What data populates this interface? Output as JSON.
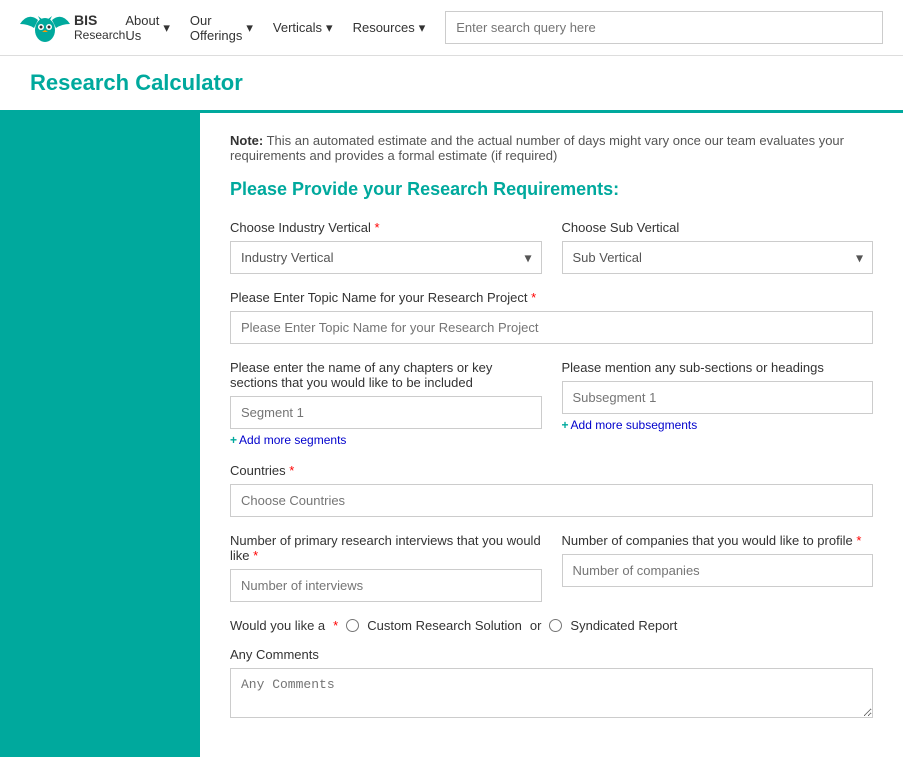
{
  "brand": {
    "bis": "BIS",
    "research": "Research"
  },
  "nav": {
    "items": [
      {
        "label": "About Us",
        "id": "about-us"
      },
      {
        "label": "Our Offerings",
        "id": "our-offerings"
      },
      {
        "label": "Verticals",
        "id": "verticals"
      },
      {
        "label": "Resources",
        "id": "resources"
      }
    ]
  },
  "search": {
    "placeholder": "Enter search query here"
  },
  "page_title": {
    "prefix": "Research ",
    "highlight": "Calculator"
  },
  "note": {
    "label": "Note:",
    "text": " This an automated estimate and the actual number of days might vary once our team evaluates your requirements and provides a formal estimate (if required)"
  },
  "form": {
    "heading": "Please Provide your Research Requirements:",
    "industry_vertical_label": "Choose Industry Vertical",
    "industry_vertical_placeholder": "Industry Vertical",
    "sub_vertical_label": "Choose Sub Vertical",
    "sub_vertical_placeholder": "Sub Vertical",
    "topic_label": "Please Enter Topic Name for your Research Project",
    "topic_placeholder": "Please Enter Topic Name for your Research Project",
    "chapters_label": "Please enter the name of any chapters or key sections that you would like to be included",
    "segment_placeholder": "Segment 1",
    "add_segments_label": "Add more segments",
    "subsections_label": "Please mention any sub-sections or headings",
    "subsegment_placeholder": "Subsegment 1",
    "add_subsegments_label": "Add more subsegments",
    "countries_label": "Countries",
    "countries_placeholder": "Choose Countries",
    "interviews_group_label": "Number of primary research interviews that you would like",
    "interviews_placeholder": "Number of interviews",
    "companies_group_label": "Number of companies that you would like to profile",
    "companies_placeholder": "Number of companies",
    "radio_prefix": "Would you like a",
    "radio_option1": "Custom Research Solution",
    "radio_or": "or",
    "radio_option2": "Syndicated Report",
    "comments_label": "Any Comments",
    "comments_placeholder": "Any Comments"
  }
}
